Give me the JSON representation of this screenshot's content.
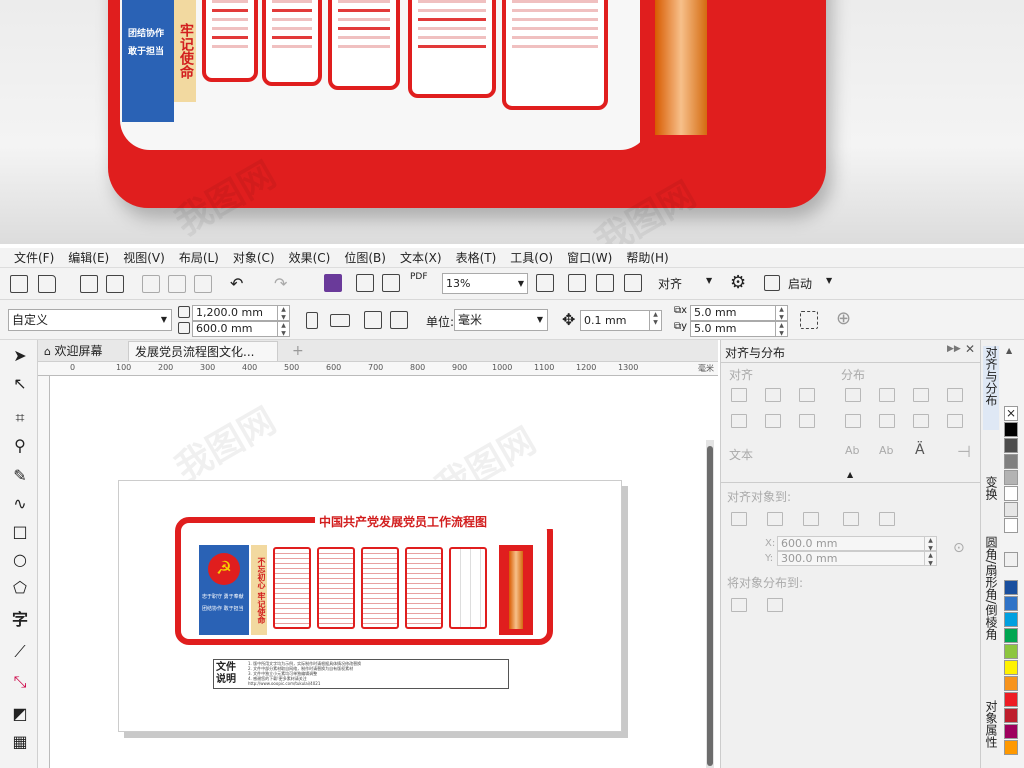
{
  "menu": [
    "文件(F)",
    "编辑(E)",
    "视图(V)",
    "布局(L)",
    "对象(C)",
    "效果(C)",
    "位图(B)",
    "文本(X)",
    "表格(T)",
    "工具(O)",
    "窗口(W)",
    "帮助(H)"
  ],
  "toolbar": {
    "zoom_value": "13%",
    "align_label": "对齐",
    "launch_label": "启动",
    "pdf_label": "PDF"
  },
  "property_bar": {
    "preset_value": "自定义",
    "width_value": "1,200.0 mm",
    "height_value": "600.0 mm",
    "units_label": "单位:",
    "units_value": "毫米",
    "nudge_value": "0.1 mm",
    "dup_x_value": "5.0 mm",
    "dup_y_value": "5.0 mm"
  },
  "tabs": [
    "欢迎屏幕",
    "发展党员流程图文化..."
  ],
  "ruler_ticks": [
    "0",
    "100",
    "200",
    "300",
    "400",
    "500",
    "600",
    "700",
    "800",
    "900",
    "1000",
    "1100",
    "1200",
    "1300"
  ],
  "ruler_unit": "毫米",
  "design": {
    "title": "中国共产党发展党员工作流程图",
    "gold_left": "不忘初心",
    "gold_right": "牢记使命",
    "blue_texts": [
      "忠于职守 勇于奉献",
      "团结协作 敢于担当"
    ],
    "notes_label": "文件说明",
    "notes_lines": [
      "1. 版中所用文字均为示例，实际制作时请根据具体情况修改替换",
      "2. 文件中部分素材取自网络，制作时请替换为自有版权素材",
      "3. 文件中独立小元素均可单独编辑调整",
      "4. 感谢您的下载!更多素材请关注",
      "http://www.ooopic.com/tukulai/4021"
    ]
  },
  "photo": {
    "blue_texts": [
      "团结协作",
      "敢于担当"
    ],
    "gold_text": "牢记使命"
  },
  "watermark": "我图网",
  "docker": {
    "title": "对齐与分布",
    "align_label": "对齐",
    "distribute_label": "分布",
    "text_label": "文本",
    "align_to_label": "对齐对象到:",
    "x_value": "600.0 mm",
    "y_value": "300.0 mm",
    "x_label": "X:",
    "y_label": "Y:",
    "distribute_to_label": "将对象分布到:"
  },
  "side_tabs": [
    "对齐与分布",
    "变换",
    "圆角/扇形角/倒棱角",
    "对象属性"
  ],
  "palette": [
    "#ffffff",
    "#000000",
    "#4d4d4d",
    "#808080",
    "#b3b3b3",
    "#1a4f9e",
    "#2f73c7",
    "#00a0e0",
    "#00a651",
    "#8dc63f",
    "#fff200",
    "#f7941d",
    "#ed1c24",
    "#be1e2d",
    "#9e005d",
    "#662d91"
  ],
  "colors": {
    "accent_red": "#e01e1e",
    "party_blue": "#2a62b5",
    "gold": "#f2d9a0"
  }
}
